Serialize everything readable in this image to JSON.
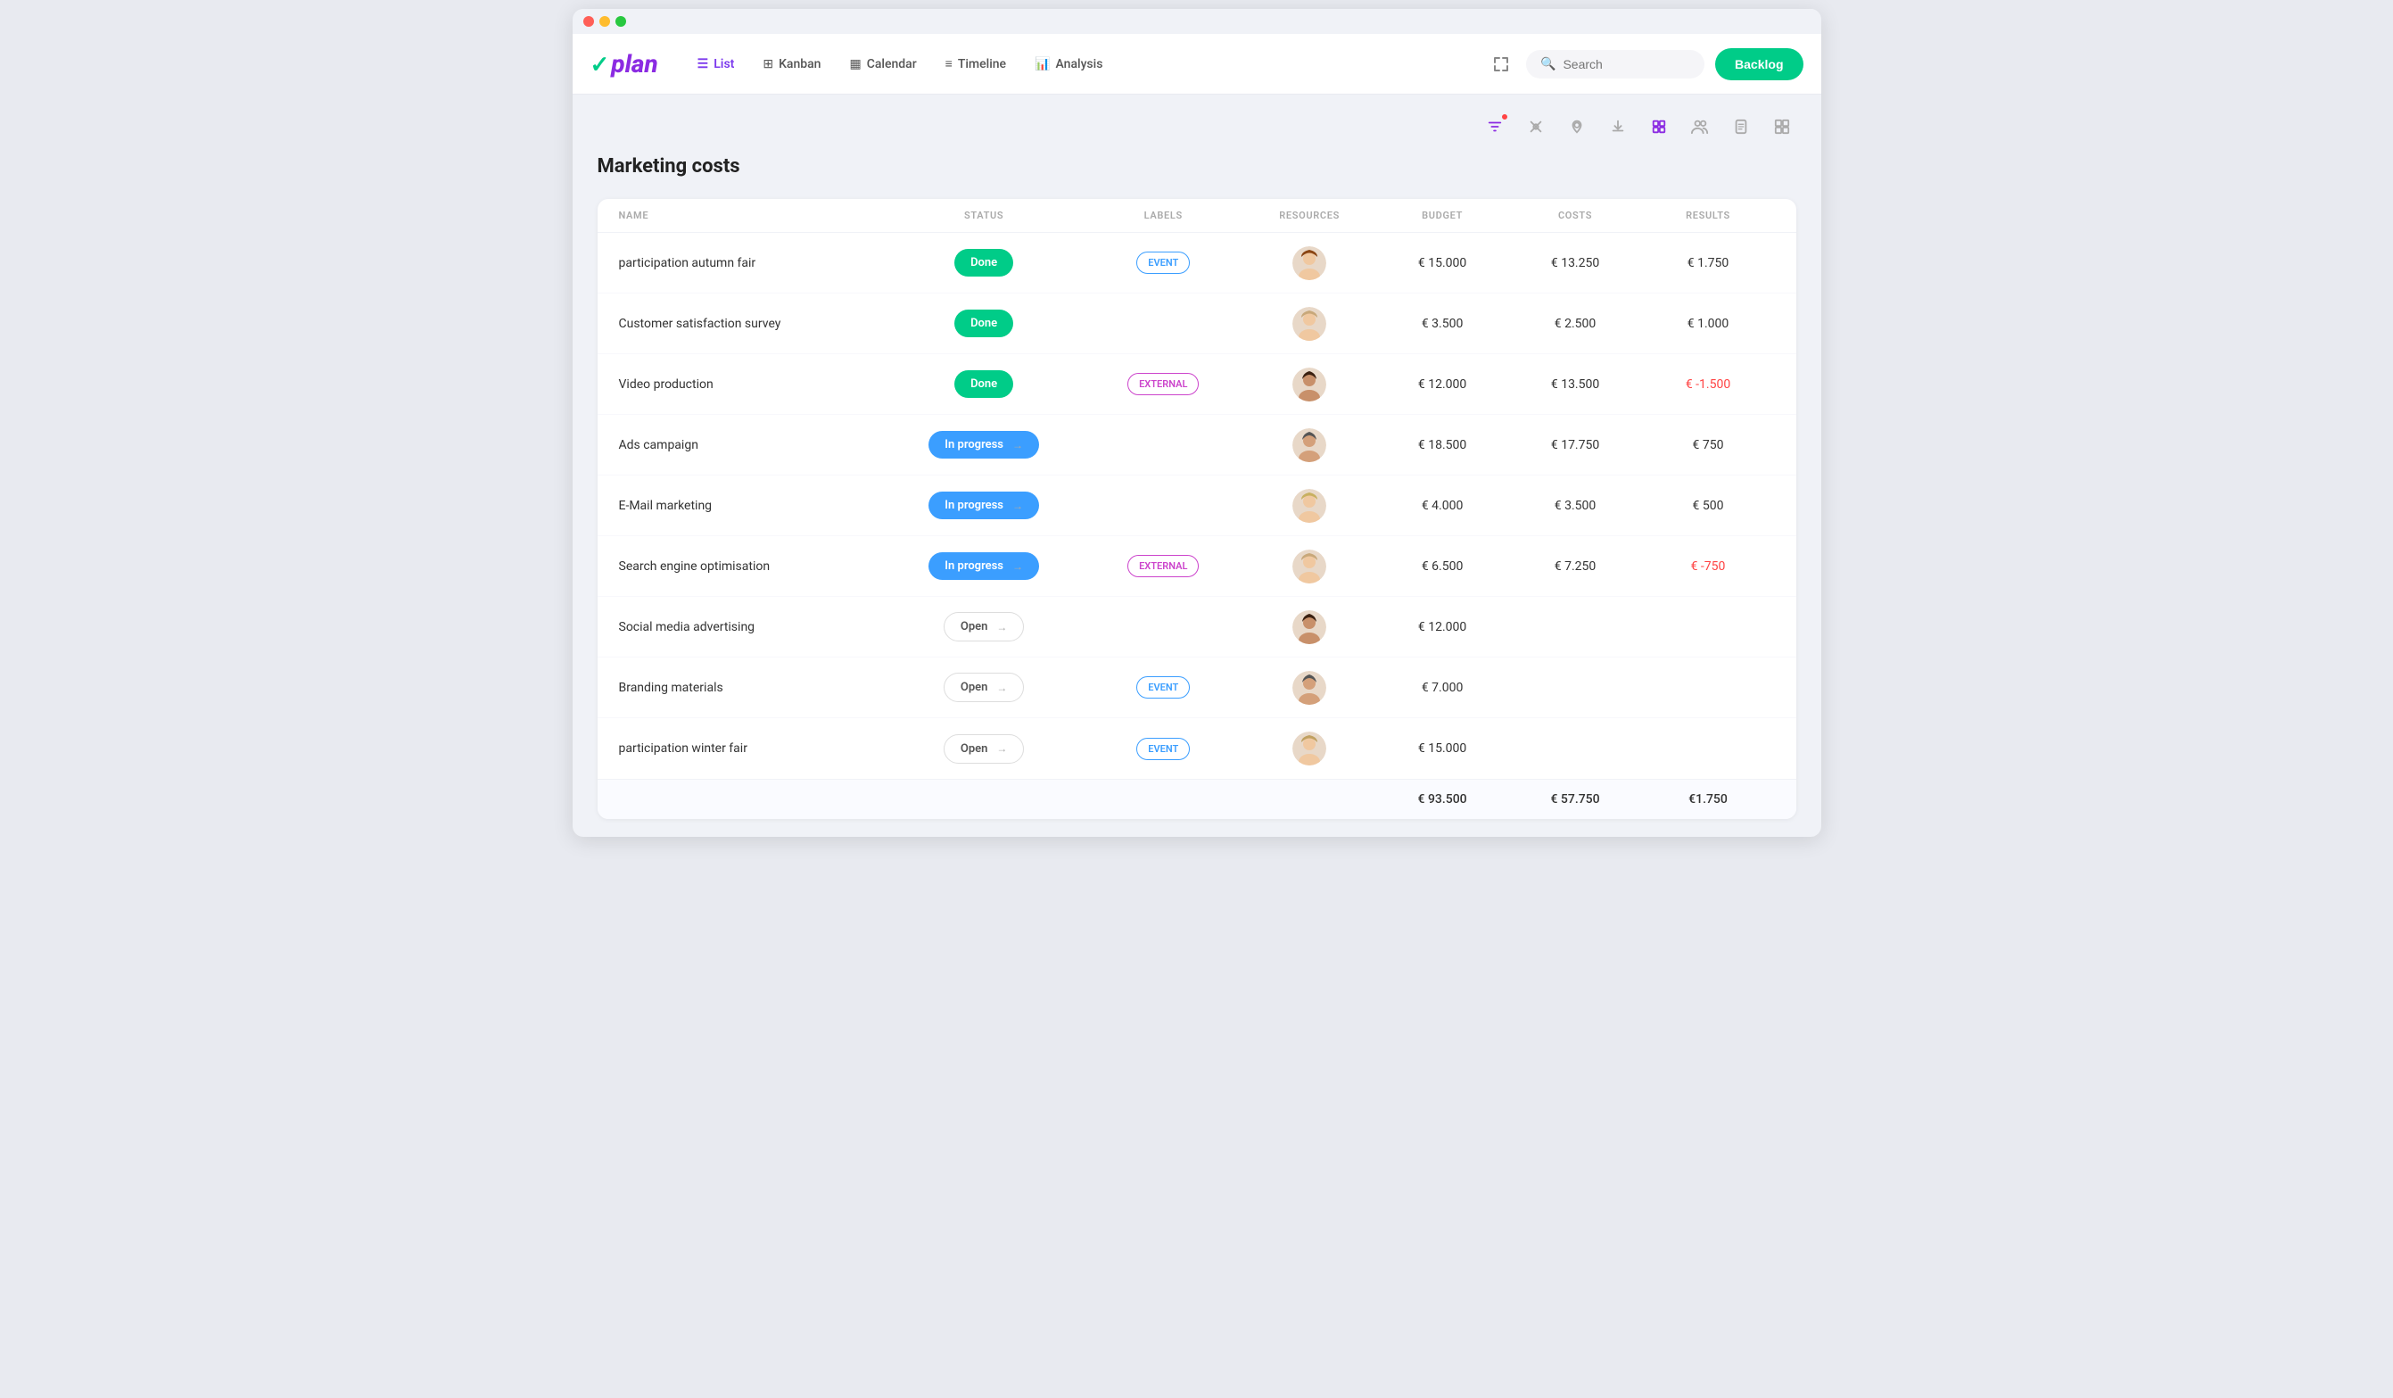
{
  "window": {
    "title": "Vplan"
  },
  "nav": {
    "logo": "vplan",
    "items": [
      {
        "id": "list",
        "label": "List",
        "active": true,
        "icon": "≡"
      },
      {
        "id": "kanban",
        "label": "Kanban",
        "active": false,
        "icon": "▦"
      },
      {
        "id": "calendar",
        "label": "Calendar",
        "active": false,
        "icon": "📅"
      },
      {
        "id": "timeline",
        "label": "Timeline",
        "active": false,
        "icon": "≡"
      },
      {
        "id": "analysis",
        "label": "Analysis",
        "active": false,
        "icon": "📊"
      }
    ],
    "backlog_label": "Backlog",
    "search_placeholder": "Search"
  },
  "page": {
    "title": "Marketing costs"
  },
  "table": {
    "headers": [
      "NAME",
      "STATUS",
      "LABELS",
      "RESOURCES",
      "BUDGET",
      "COSTS",
      "RESULTS"
    ],
    "rows": [
      {
        "name": "participation autumn fair",
        "status": "Done",
        "status_type": "done",
        "label": "EVENT",
        "label_type": "event",
        "avatar_id": 1,
        "budget": "€ 15.000",
        "costs": "€ 13.250",
        "results": "€ 1.750"
      },
      {
        "name": "Customer satisfaction survey",
        "status": "Done",
        "status_type": "done",
        "label": "",
        "label_type": "",
        "avatar_id": 2,
        "budget": "€ 3.500",
        "costs": "€ 2.500",
        "results": "€ 1.000"
      },
      {
        "name": "Video production",
        "status": "Done",
        "status_type": "done",
        "label": "EXTERNAL",
        "label_type": "external",
        "avatar_id": 3,
        "budget": "€ 12.000",
        "costs": "€ 13.500",
        "results": "€ -1.500"
      },
      {
        "name": "Ads campaign",
        "status": "In progress",
        "status_type": "in-progress",
        "label": "",
        "label_type": "",
        "avatar_id": 4,
        "budget": "€ 18.500",
        "costs": "€ 17.750",
        "results": "€ 750"
      },
      {
        "name": "E-Mail marketing",
        "status": "In progress",
        "status_type": "in-progress",
        "label": "",
        "label_type": "",
        "avatar_id": 5,
        "budget": "€ 4.000",
        "costs": "€ 3.500",
        "results": "€ 500"
      },
      {
        "name": "Search engine optimisation",
        "status": "In progress",
        "status_type": "in-progress",
        "label": "EXTERNAL",
        "label_type": "external",
        "avatar_id": 6,
        "budget": "€ 6.500",
        "costs": "€ 7.250",
        "results": "€ -750"
      },
      {
        "name": "Social media advertising",
        "status": "Open",
        "status_type": "open",
        "label": "",
        "label_type": "",
        "avatar_id": 3,
        "budget": "€ 12.000",
        "costs": "",
        "results": ""
      },
      {
        "name": "Branding materials",
        "status": "Open",
        "status_type": "open",
        "label": "EVENT",
        "label_type": "event",
        "avatar_id": 4,
        "budget": "€ 7.000",
        "costs": "",
        "results": ""
      },
      {
        "name": "participation winter fair",
        "status": "Open",
        "status_type": "open",
        "label": "EVENT",
        "label_type": "event",
        "avatar_id": 7,
        "budget": "€ 15.000",
        "costs": "",
        "results": ""
      }
    ],
    "footer": {
      "budget_total": "€ 93.500",
      "costs_total": "€ 57.750",
      "results_total": "€1.750"
    }
  }
}
